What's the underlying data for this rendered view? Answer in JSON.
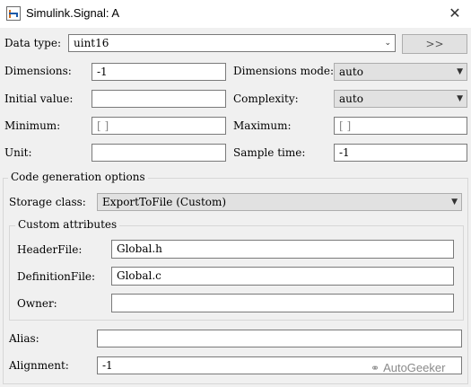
{
  "window": {
    "title": "Simulink.Signal: A"
  },
  "data_type": {
    "label": "Data type:",
    "value": "uint16",
    "expand_button": ">>"
  },
  "dimensions": {
    "label": "Dimensions:",
    "value": "-1"
  },
  "dimensions_mode": {
    "label": "Dimensions mode:",
    "value": "auto"
  },
  "initial_value": {
    "label": "Initial value:",
    "value": ""
  },
  "complexity": {
    "label": "Complexity:",
    "value": "auto"
  },
  "minimum": {
    "label": "Minimum:",
    "value": "[ ]"
  },
  "maximum": {
    "label": "Maximum:",
    "value": "[ ]"
  },
  "unit": {
    "label": "Unit:",
    "value": ""
  },
  "sample_time": {
    "label": "Sample time:",
    "value": "-1"
  },
  "code_generation": {
    "title": "Code generation options",
    "storage_class": {
      "label": "Storage class:",
      "value": "ExportToFile (Custom)"
    },
    "custom_attributes": {
      "title": "Custom attributes",
      "header_file": {
        "label": "HeaderFile:",
        "value": "Global.h"
      },
      "definition_file": {
        "label": "DefinitionFile:",
        "value": "Global.c"
      },
      "owner": {
        "label": "Owner:",
        "value": ""
      }
    },
    "alias": {
      "label": "Alias:",
      "value": ""
    },
    "alignment": {
      "label": "Alignment:",
      "value": "-1"
    }
  },
  "watermark": {
    "text": "AutoGeeker",
    "icon": "wechat-icon"
  }
}
